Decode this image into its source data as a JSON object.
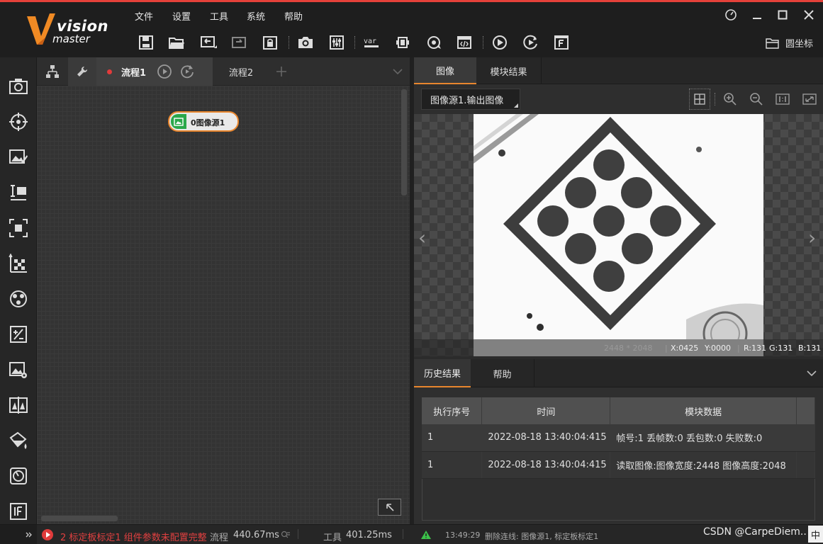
{
  "logo": {
    "line1": "vision",
    "line2": "master"
  },
  "menu": [
    "文件",
    "设置",
    "工具",
    "系统",
    "帮助"
  ],
  "toolbar": {
    "icons": [
      "save-icon",
      "open-folder-icon",
      "undo-icon",
      "redo-icon",
      "lock-icon",
      "camera-icon",
      "equalizer-icon",
      "variable-icon",
      "communication-icon",
      "global-trigger-icon",
      "script-icon",
      "run-once-icon",
      "run-loop-icon",
      "file-icon"
    ],
    "var_label": "var",
    "coord_label": "圆坐标"
  },
  "flow": {
    "tab1": "流程1",
    "tab2": "流程2",
    "node_label": "0图像源1"
  },
  "image_panel": {
    "tabs": [
      "图像",
      "模块结果"
    ],
    "source_select": "图像源1.输出图像",
    "status": {
      "size": "2448 * 2048",
      "x": "X:0425",
      "y": "Y:0000",
      "r": "R:131",
      "g": "G:131",
      "b": "B:131"
    }
  },
  "history": {
    "tabs": [
      "历史结果",
      "帮助"
    ],
    "columns": [
      "执行序号",
      "时间",
      "模块数据"
    ],
    "rows": [
      {
        "id": "1",
        "time": "2022-08-18 13:40:04:415",
        "data": "帧号:1 丢帧数:0 丢包数:0 失败数:0"
      },
      {
        "id": "1",
        "time": "2022-08-18 13:40:04:415",
        "data": "读取图像:图像宽度:2448 图像高度:2048"
      }
    ]
  },
  "statusbar": {
    "error_text": "2 标定板标定1 组件参数未配置完整",
    "flow_label": "流程",
    "flow_time": "440.67ms",
    "tool_label": "工具",
    "tool_time": "401.25ms",
    "log_time": "13:49:29",
    "log_text": "删除连线: 图像源1, 标定板标定1",
    "watermark": "CSDN @CarpeDiem..",
    "ime": "中"
  },
  "colors": {
    "accent": "#e5413a",
    "node_border": "#e8862e",
    "node_icon": "#2aa84a",
    "tab_active": "#e8862e"
  }
}
